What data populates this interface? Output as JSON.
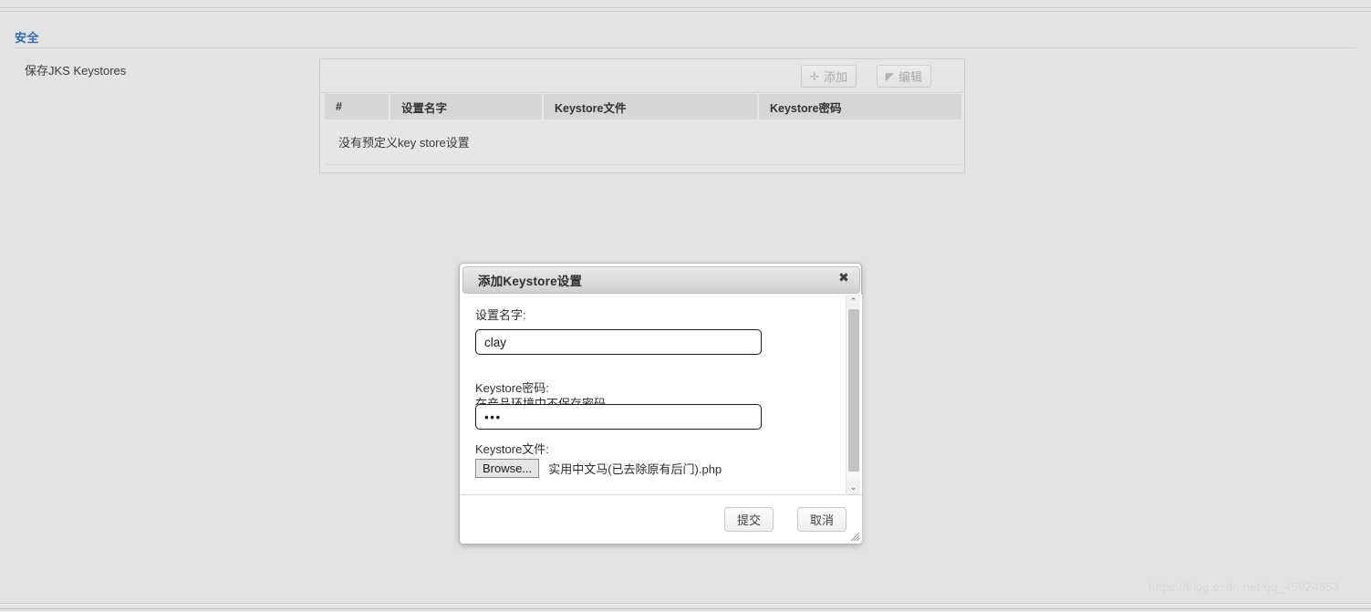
{
  "page": {
    "background_color": "#e3e3e3",
    "watermark": "https://blog.csdn.net/qq_45924653"
  },
  "section": {
    "heading": "安全",
    "heading_color": "#2b6cb0"
  },
  "form": {
    "row_label": "保存JKS Keystores"
  },
  "panel": {
    "toolbar": {
      "add_label": "添加",
      "add_icon": "plus-icon",
      "add_icon_glyph": "✛",
      "edit_label": "编辑",
      "edit_icon": "tag-icon",
      "edit_icon_glyph": "◤"
    },
    "table": {
      "columns": [
        "#",
        "设置名字",
        "Keystore文件",
        "Keystore密码"
      ],
      "rows": [],
      "empty_message": "没有预定义key store设置"
    }
  },
  "dialog": {
    "title": "添加Keystore设置",
    "close_icon": "close-icon",
    "close_glyph": "✖",
    "fields": {
      "name": {
        "label": "设置名字:",
        "value": "clay",
        "placeholder": ""
      },
      "password": {
        "label": "Keystore密码:\n在产品环境中不保存密码。",
        "value": "•••",
        "placeholder": ""
      },
      "file": {
        "label": "Keystore文件:",
        "browse_label": "Browse...",
        "file_name": "实用中文马(已去除原有后门).php"
      }
    },
    "scrollbar": {
      "up_icon": "chevron-up-icon",
      "up_glyph": "⌃",
      "down_icon": "chevron-down-icon",
      "down_glyph": "⌄"
    },
    "footer": {
      "submit_label": "提交",
      "cancel_label": "取消"
    },
    "resize_icon": "resize-grip-icon"
  }
}
